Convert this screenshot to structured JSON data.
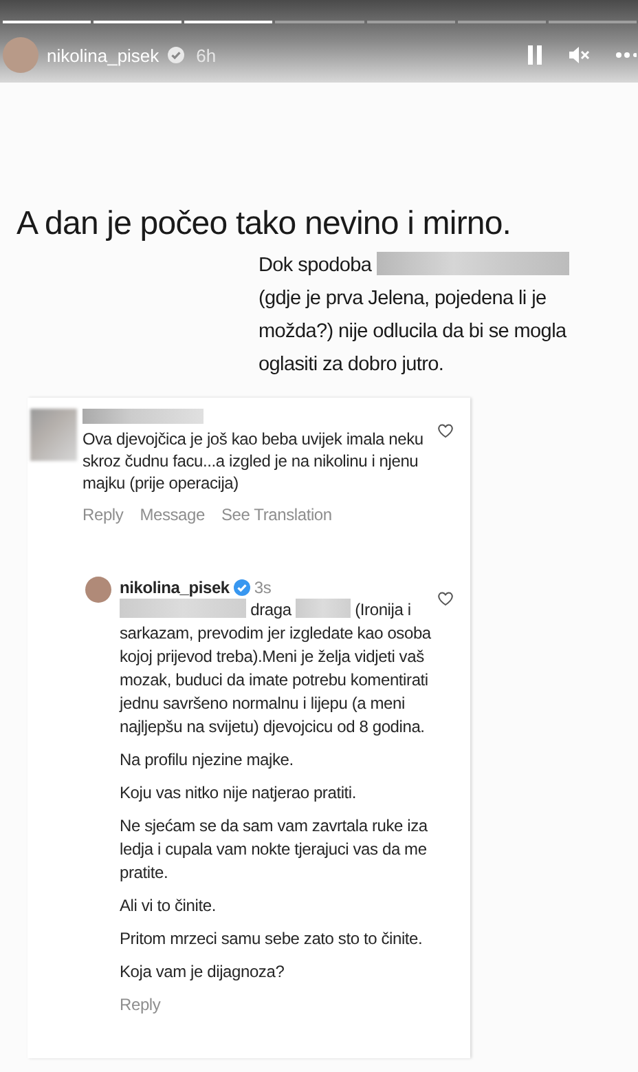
{
  "progress": [
    {
      "seen": true
    },
    {
      "seen": true
    },
    {
      "seen": true
    },
    {
      "seen": false
    },
    {
      "seen": false
    },
    {
      "seen": false
    },
    {
      "seen": false
    }
  ],
  "header": {
    "username": "nikolina_pisek",
    "verified": true,
    "time": "6h"
  },
  "caption": {
    "title": "A dan je počeo tako nevino i mirno.",
    "text": [
      {
        "kind": "text",
        "text": "Dok spodoba"
      },
      {
        "kind": "redacted"
      },
      {
        "kind": "text",
        "text": "(gdje je prva Jelena, pojedena li je možda?) nije odlucila da bi se mogla oglasiti za dobro jutro."
      }
    ]
  },
  "comment": {
    "author": {
      "kind": "redacted"
    },
    "body": "Ova djevojčica je još kao beba uvijek imala neku skroz čudnu facu...a izgled je na nikolinu i njenu majku (prije operacija)",
    "liked": false,
    "actions": [
      "Reply",
      "Message",
      "See Translation"
    ]
  },
  "reply": {
    "username": "nikolina_pisek",
    "verified": true,
    "time": "3s",
    "liked": false,
    "paragraphs": [
      [
        {
          "kind": "redacted"
        },
        {
          "kind": "text",
          "text": "draga"
        },
        {
          "kind": "redacted"
        },
        {
          "kind": "text",
          "text": "(Ironija i"
        },
        {
          "kind": "text",
          "text": "sarkazam, prevodim jer izgledate kao osoba kojoj prijevod treba).Meni je želja vidjeti vaš mozak, buduci da imate potrebu komentirati jednu savršeno normalnu i lijepu (a meni najljepšu na svijetu) djevojcicu od 8 godina."
        }
      ],
      [
        {
          "kind": "text",
          "text": "Na profilu njezine majke."
        }
      ],
      [
        {
          "kind": "text",
          "text": "Koju vas nitko nije natjerao pratiti."
        }
      ],
      [
        {
          "kind": "text",
          "text": "Ne sjećam se da sam vam zavrtala ruke iza ledja i cupala vam nokte tjerajuci vas da me pratite."
        }
      ],
      [
        {
          "kind": "text",
          "text": "Ali vi to činite."
        }
      ],
      [
        {
          "kind": "text",
          "text": "Pritom mrzeci samu sebe zato sto to činite."
        }
      ],
      [
        {
          "kind": "text",
          "text": "Koja vam je dijagnoza?"
        }
      ]
    ],
    "actions": [
      "Reply"
    ]
  }
}
